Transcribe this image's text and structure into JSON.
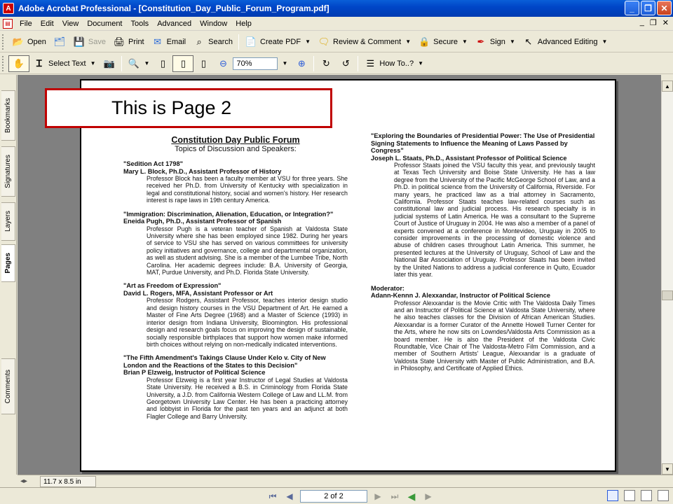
{
  "window": {
    "title": "Adobe Acrobat Professional - [Constitution_Day_Public_Forum_Program.pdf]"
  },
  "menu": [
    "File",
    "Edit",
    "View",
    "Document",
    "Tools",
    "Advanced",
    "Window",
    "Help"
  ],
  "toolbar1": {
    "open": "Open",
    "save": "Save",
    "print": "Print",
    "email": "Email",
    "search": "Search",
    "create_pdf": "Create PDF",
    "review": "Review & Comment",
    "secure": "Secure",
    "sign": "Sign",
    "advanced_editing": "Advanced Editing"
  },
  "toolbar2": {
    "select_text": "Select Text",
    "zoom": "70%",
    "how_to": "How To..?"
  },
  "side_tabs": [
    "Bookmarks",
    "Signatures",
    "Layers",
    "Pages",
    "Comments"
  ],
  "document": {
    "banner": "This is Page 2",
    "heading": "Constitution Day Public Forum",
    "subheading": "Topics of Discussion and Speakers:",
    "left_entries": [
      {
        "title": "\"Sedition Act 1798\"",
        "name": "Mary L. Block, Ph.D., Assistant Professor of History",
        "body": "Professor Block has been a faculty member at VSU for three years. She received her Ph.D. from University of Kentucky with specialization in legal and constitutional history, social and women's history. Her research interest is rape laws in 19th century America."
      },
      {
        "title": "\"Immigration: Discrimination, Alienation, Education, or Integration?\"",
        "name": "Eneida Pugh, Ph.D., Assistant Professor of Spanish",
        "body": "Professor Pugh is a veteran teacher of Spanish at Valdosta State University where she has been employed since 1982. During her years of service to VSU she has served on various committees for university policy initiatives and governance, college and departmental organization, as well as student advising. She is a member of the Lumbee Tribe, North Carolina. Her academic degrees include: B.A. University of Georgia, MAT, Purdue University, and Ph.D. Florida State University."
      },
      {
        "title": "\"Art as Freedom of Expression\"",
        "name": "David L. Rogers, MFA, Assistant Professor or Art",
        "body": "Professor Rodgers, Assistant Professor, teaches interior design studio and design history courses in the VSU Department of Art. He earned a Master of Fine Arts Degree (1968) and a Master of Science (1993) in interior design from Indiana University, Bloomington. His professional design and research goals focus on improving the design of sustainable, socially responsible birthplaces that support how women make informed birth choices without relying on non-medically indicated interventions."
      },
      {
        "title": "\"The Fifth Amendment's Takings Clause Under Kelo v. City of New London and the Reactions of the States to this Decision\"",
        "name": "Brian P Elzweig, Instructor of Political Science",
        "body": "Professor Elzweig is a first year Instructor of Legal Studies at Valdosta State University. He received a B.S. in Criminology from Florida State University, a J.D. from California Western College of Law and LL.M. from Georgetown University Law Center. He has been a practicing attorney and lobbyist in Florida for the past ten years and an adjunct at both Flagler College and Barry University."
      }
    ],
    "right_entries": [
      {
        "title": "\"Exploring the Boundaries of Presidential Power: The Use of Presidential Signing Statements to Influence the Meaning of Laws Passed by Congress\"",
        "name": "Joseph L. Staats, Ph.D., Assistant Professor of Political Science",
        "body": "Professor Staats joined the VSU faculty this year, and previously taught at Texas Tech University and Boise State University. He has a law degree from the University of the Pacific McGeorge School of Law, and a Ph.D. in political science from the University of California, Riverside. For many years, he practiced law as a trial attorney in Sacramento, California. Professor Staats teaches law-related courses such as constitutional law and judicial process. His research specialty is in judicial systems of Latin America. He was a consultant to the Supreme Court of Justice of Uruguay in 2004. He was also a member of a panel of experts convened at a conference in Montevideo, Uruguay in 2005 to consider improvements in the processing of domestic violence and abuse of children cases throughout Latin America. This summer, he presented lectures at the University of Uruguay, School of Law and the National Bar Association of Uruguay. Professor Staats has been invited by the United Nations to address a judicial conference in Quito, Ecuador later this year."
      }
    ],
    "moderator_label": "Moderator:",
    "moderator": {
      "name": "Adann-Kennn J. Alexxandar, Instructor of Political Science",
      "body": "Professor Alexxandar is the Movie Critic with The Valdosta Daily Times and an Instructor of Political Science at Valdosta State University, where he also teaches classes for the Division of African American Studies. Alexxandar is a former Curator of the Annette Howell Turner Center for the Arts, where he now sits on Lowndes/Valdosta Arts Commission as a board member. He is also the President of the Valdosta Civic Roundtable, Vice Chair of The Valdosta-Metro Film Commission, and a member of Southern Artists' League, Alexxandar is a graduate of Valdosta State University with Master of Public Administration, and B.A. in Philosophy, and Certificate of Applied Ethics."
    }
  },
  "status": {
    "page_size": "11.7 x 8.5 in",
    "page_number": "2 of 2"
  }
}
